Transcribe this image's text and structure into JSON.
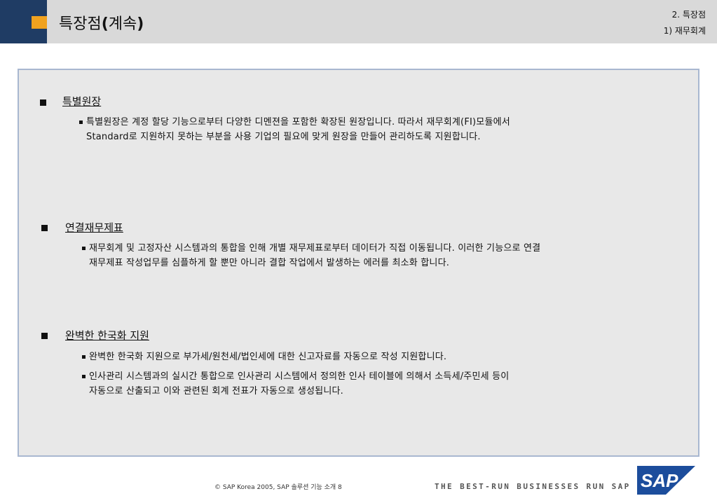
{
  "header": {
    "title_plain": "특장점",
    "title_bold": "(",
    "title_mid": "계속",
    "title_bold_end": ")",
    "section": "2. 특장점",
    "subsection": "1) 재무회계"
  },
  "sections": [
    {
      "title": "특별원장",
      "items": [
        [
          "특별원장은 계정 할당 기능으로부터 다양한 디멘젼을 포함한 확장된 원장입니다. 따라서 재무회계(FI)모듈에서",
          "Standard로 지원하지 못하는 부분을 사용 기업의 필요에 맞게 원장을 만들어 관리하도록 지원합니다."
        ]
      ]
    },
    {
      "title": "연결재무제표",
      "items": [
        [
          "재무회계 및 고정자산 시스템과의 통합을 인해 개별 재무제표로부터 데이터가 직접 이동됩니다. 이러한 기능으로 연결",
          "재무제표 작성업무를 심플하게 할 뿐만 아니라 결합 작업에서 발생하는 에러를 최소화 합니다."
        ]
      ]
    },
    {
      "title": "완벽한 한국화 지원",
      "items": [
        [
          "완벽한 한국화 지원으로 부가세/원천세/법인세에 대한 신고자료를 자동으로 작성 지원합니다."
        ],
        [
          "인사관리 시스템과의 실시간 통합으로 인사관리 시스템에서 정의한 인사 테이블에 의해서 소득세/주민세 등이",
          "자동으로 산출되고 이와 관련된 회계 전표가 자동으로 생성됩니다."
        ]
      ]
    }
  ],
  "footer": {
    "copyright": "©  SAP Korea 2005, SAP 솔루션 기능 소개    8",
    "tagline": "THE BEST-RUN BUSINESSES RUN SAP",
    "logo_text": "SAP",
    "logo_colors": {
      "blue": "#1c4d9c",
      "black": "#111111",
      "white": "#ffffff"
    }
  }
}
